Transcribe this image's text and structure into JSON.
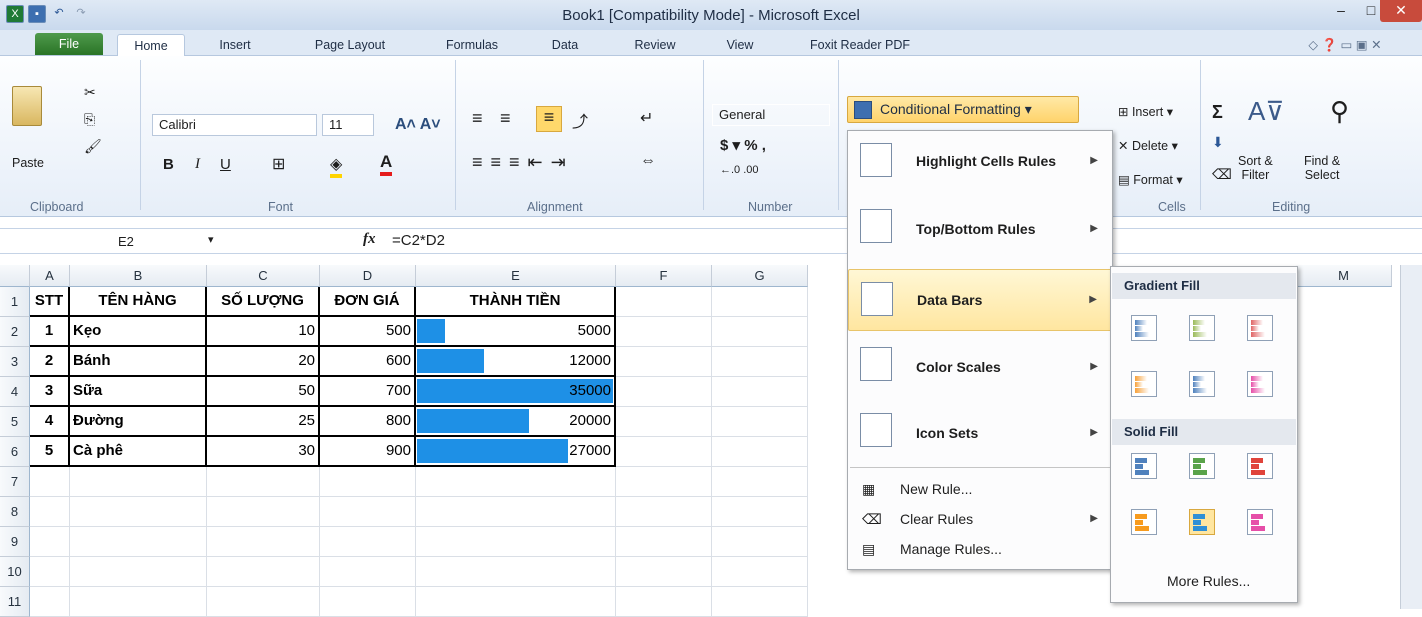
{
  "window": {
    "title": "Book1  [Compatibility Mode]  -  Microsoft Excel"
  },
  "tabs": [
    "File",
    "Home",
    "Insert",
    "Page Layout",
    "Formulas",
    "Data",
    "Review",
    "View",
    "Foxit Reader PDF"
  ],
  "ribbon": {
    "paste_label": "Paste",
    "clipboard_label": "Clipboard",
    "font_label": "Font",
    "alignment_label": "Alignment",
    "number_label": "Number",
    "cells_label": "Cells",
    "editing_label": "Editing",
    "font_name": "Calibri",
    "font_size": "11",
    "number_format": "General",
    "cf_button": "Conditional Formatting",
    "insert": "Insert",
    "delete": "Delete",
    "format": "Format",
    "sort_filter": "Sort &\nFilter",
    "find_select": "Find &\nSelect",
    "bold": "B",
    "italic": "I",
    "underline": "U"
  },
  "formula_bar": {
    "name_box": "E2",
    "fx": "fx",
    "formula": "=C2*D2"
  },
  "sheet": {
    "columns": [
      "A",
      "B",
      "C",
      "D",
      "E",
      "F",
      "G",
      "M"
    ],
    "rows": [
      "1",
      "2",
      "3",
      "4",
      "5",
      "6",
      "7",
      "8",
      "9",
      "10",
      "11"
    ],
    "header": [
      "STT",
      "TÊN HÀNG",
      "SỐ LƯỢNG",
      "ĐƠN GIÁ",
      "THÀNH TIỀN"
    ],
    "data": [
      [
        "1",
        "Kẹo",
        "10",
        "500",
        "5000"
      ],
      [
        "2",
        "Bánh",
        "20",
        "600",
        "12000"
      ],
      [
        "3",
        "Sữa",
        "50",
        "700",
        "35000"
      ],
      [
        "4",
        "Đường",
        "25",
        "800",
        "20000"
      ],
      [
        "5",
        "Cà phê",
        "30",
        "900",
        "27000"
      ]
    ],
    "bar_fraction": [
      0.143,
      0.343,
      1.0,
      0.571,
      0.771
    ]
  },
  "cf_menu": {
    "items": [
      "Highlight Cells Rules",
      "Top/Bottom Rules",
      "Data Bars",
      "Color Scales",
      "Icon Sets"
    ],
    "small_items": [
      "New Rule...",
      "Clear Rules",
      "Manage Rules..."
    ]
  },
  "data_bars_menu": {
    "gradient_fill": "Gradient Fill",
    "solid_fill": "Solid Fill",
    "more_rules": "More Rules..."
  },
  "colors": {
    "bar_blue": "#1e90e6",
    "green": "#2a7426",
    "highlight": "#ffe6a0"
  }
}
